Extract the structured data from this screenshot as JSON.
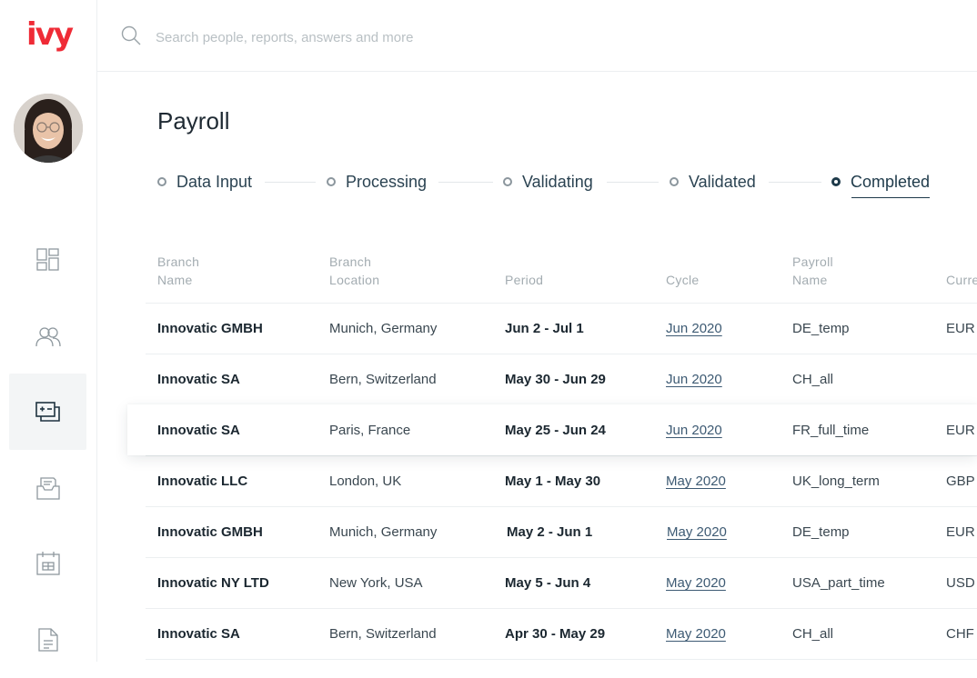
{
  "app": {
    "logo": "ivy"
  },
  "search": {
    "placeholder": "Search people, reports, answers and more"
  },
  "page": {
    "title": "Payroll"
  },
  "steps": [
    {
      "label": "Data Input",
      "active": false
    },
    {
      "label": "Processing",
      "active": false
    },
    {
      "label": "Validating",
      "active": false
    },
    {
      "label": "Validated",
      "active": false
    },
    {
      "label": "Completed",
      "active": true
    }
  ],
  "sidebar": {
    "items": [
      {
        "icon": "dashboard-icon",
        "active": false
      },
      {
        "icon": "people-icon",
        "active": false
      },
      {
        "icon": "payroll-icon",
        "active": true
      },
      {
        "icon": "documents-tray-icon",
        "active": false
      },
      {
        "icon": "calendar-icon",
        "active": false
      },
      {
        "icon": "file-icon",
        "active": false
      }
    ]
  },
  "table": {
    "headers": {
      "branch_name": [
        "Branch",
        "Name"
      ],
      "branch_location": [
        "Branch",
        "Location"
      ],
      "period": "Period",
      "cycle": "Cycle",
      "payroll_name": [
        "Payroll",
        "Name"
      ],
      "currency": "Curre"
    },
    "rows": [
      {
        "name": "Innovatic GMBH",
        "location": "Munich, Germany",
        "period": "Jun 2 - Jul 1",
        "cycle": "Jun 2020",
        "payroll": "DE_temp",
        "currency": "EUR"
      },
      {
        "name": "Innovatic SA",
        "location": "Bern, Switzerland",
        "period": "May 30 - Jun 29",
        "cycle": "Jun 2020",
        "payroll": "CH_all",
        "currency": ""
      },
      {
        "name": "Innovatic SA",
        "location": "Paris, France",
        "period": "May 25 - Jun 24",
        "cycle": "Jun 2020",
        "payroll": "FR_full_time",
        "currency": "EUR"
      },
      {
        "name": "Innovatic LLC",
        "location": "London, UK",
        "period": "May 1 - May 30",
        "cycle": "May 2020",
        "payroll": "UK_long_term",
        "currency": "GBP"
      },
      {
        "name": "Innovatic GMBH",
        "location": "Munich, Germany",
        "period": "May 2 - Jun 1",
        "cycle": "May 2020",
        "payroll": "DE_temp",
        "currency": "EUR"
      },
      {
        "name": "Innovatic NY LTD",
        "location": "New York, USA",
        "period": "May 5 - Jun 4",
        "cycle": "May 2020",
        "payroll": "USA_part_time",
        "currency": "USD"
      },
      {
        "name": "Innovatic SA",
        "location": "Bern, Switzerland",
        "period": "Apr 30  - May 29",
        "cycle": "May 2020",
        "payroll": "CH_all",
        "currency": "CHF"
      }
    ]
  },
  "colors": {
    "brand": "#ef2b36",
    "accent": "#1e3a4a",
    "link": "#3d5a73"
  }
}
